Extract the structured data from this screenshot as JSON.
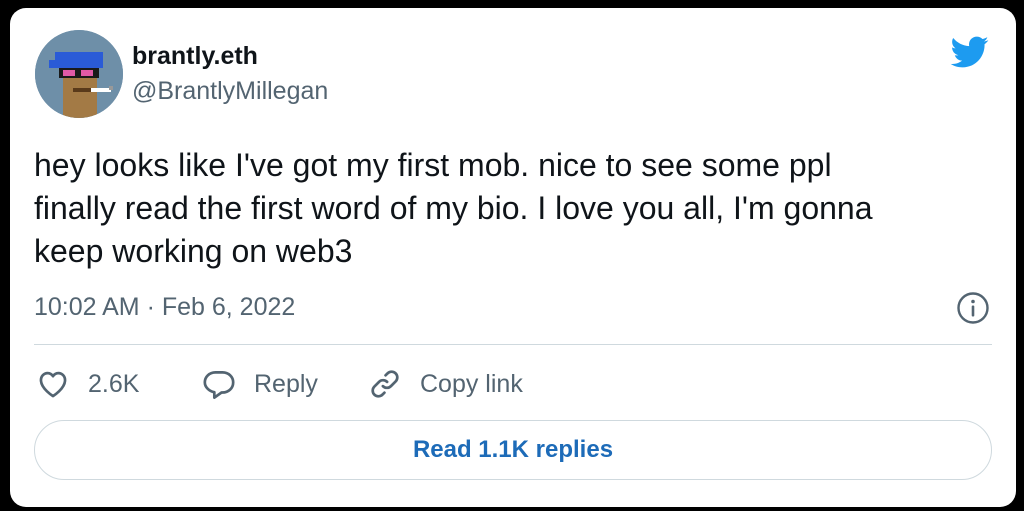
{
  "author": {
    "display_name": "brantly.eth",
    "handle": "@BrantlyMillegan",
    "avatar": "avatar-icon"
  },
  "tweet": {
    "text": "hey looks like I've got my first mob. nice to see some ppl\nfinally read the first word of my bio. I love you all, I'm gonna\nkeep working on web3",
    "timestamp": "10:02 AM · Feb 6, 2022"
  },
  "actions": {
    "like_count": "2.6K",
    "reply_label": "Reply",
    "copy_link_label": "Copy link"
  },
  "replies_button": {
    "label": "Read 1.1K replies"
  },
  "icons": {
    "brand": "twitter-bird-icon",
    "info": "info-icon",
    "like": "heart-icon",
    "reply": "speech-bubble-icon",
    "copy": "link-icon"
  },
  "colors": {
    "brand_blue": "#1d9bf0",
    "link_blue": "#1d6bb8",
    "secondary_text": "#536471",
    "border": "#cfd9de",
    "background": "#000000",
    "card": "#ffffff"
  }
}
